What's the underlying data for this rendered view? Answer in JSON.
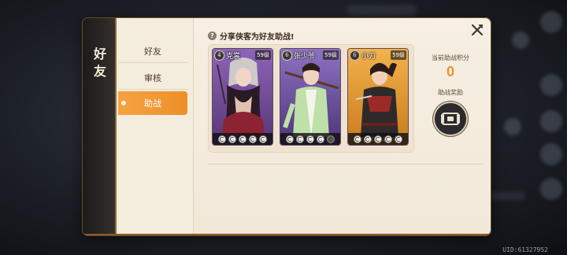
{
  "panel": {
    "title": "好友",
    "tabs": [
      {
        "label": "好友",
        "active": false
      },
      {
        "label": "审核",
        "active": false
      },
      {
        "label": "助战",
        "active": true
      }
    ]
  },
  "assist": {
    "heading": "分享侠客为好友助战!",
    "help_icon": "?",
    "cards": [
      {
        "star": "4",
        "name": "克裳",
        "level": "59级",
        "theme": "purple",
        "gems": 5
      },
      {
        "star": "6",
        "name": "张少爷",
        "level": "59级",
        "theme": "violet",
        "gems": 5
      },
      {
        "star": "6",
        "name": "小刀",
        "level": "59级",
        "theme": "gold",
        "gems": 5
      }
    ],
    "score_label": "当前助战积分",
    "score_value": "0",
    "reward_label": "助战奖励",
    "reward_icon": "scroll-icon"
  },
  "footer": {
    "uid": "UID:61327952"
  },
  "colors": {
    "accent": "#ee8f28",
    "panel_bg": "#f6efe2",
    "spine": "#1b1a1a"
  }
}
